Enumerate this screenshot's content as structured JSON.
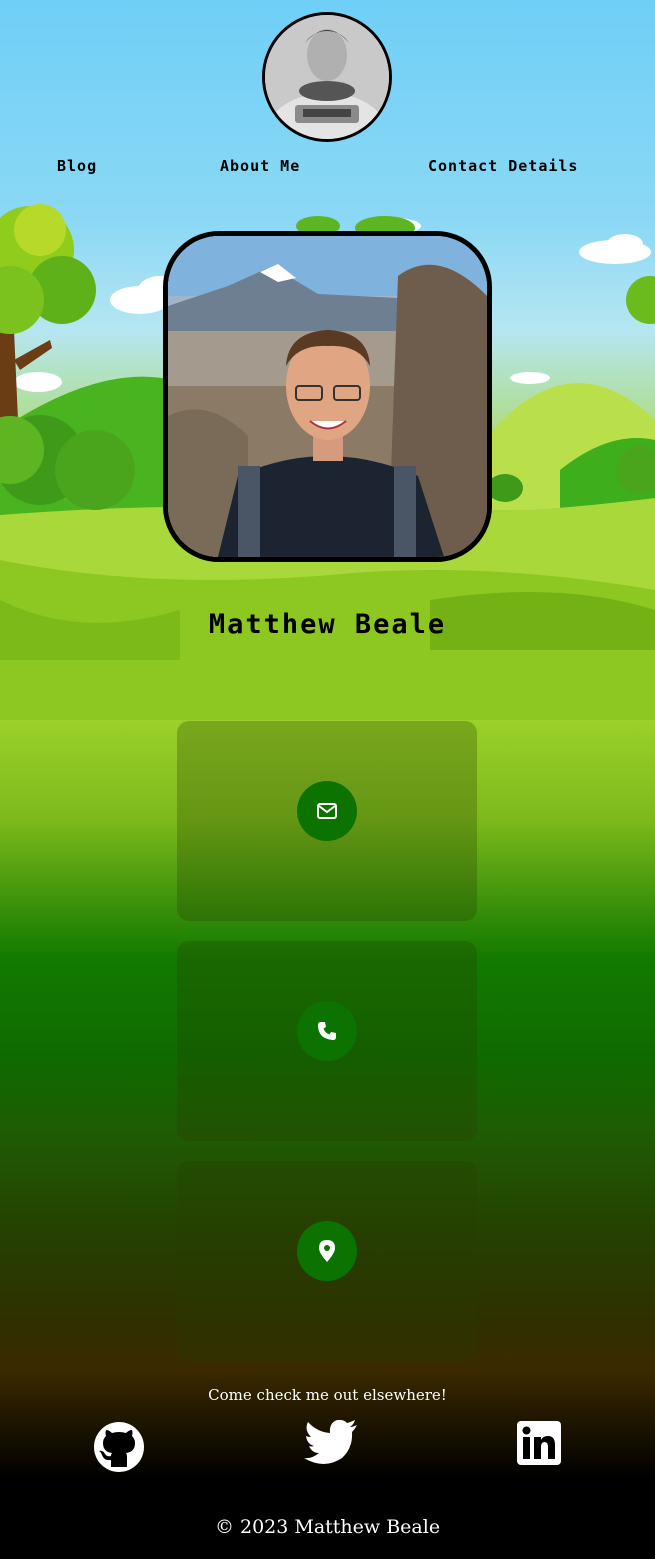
{
  "header": {
    "avatar_alt": "astronaut-portrait",
    "nav": [
      {
        "label": "Blog"
      },
      {
        "label": "About Me"
      },
      {
        "label": "Contact Details"
      }
    ]
  },
  "profile": {
    "name": "Matthew Beale",
    "photo": "portrait-photo"
  },
  "contact_cards": [
    {
      "icon": "envelope-icon"
    },
    {
      "icon": "phone-icon"
    },
    {
      "icon": "location-pin-icon"
    }
  ],
  "social": {
    "heading": "Come check me out elsewhere!",
    "links": [
      {
        "icon": "github-icon"
      },
      {
        "icon": "twitter-icon"
      },
      {
        "icon": "linkedin-icon"
      }
    ]
  },
  "footer": {
    "copyright": "© 2023 Matthew Beale"
  },
  "colors": {
    "sky": "#6fcff6",
    "grass": "#9ed12a",
    "icon_circle": "#0c7300",
    "text_dark": "#000000",
    "text_light": "#ffffff"
  }
}
